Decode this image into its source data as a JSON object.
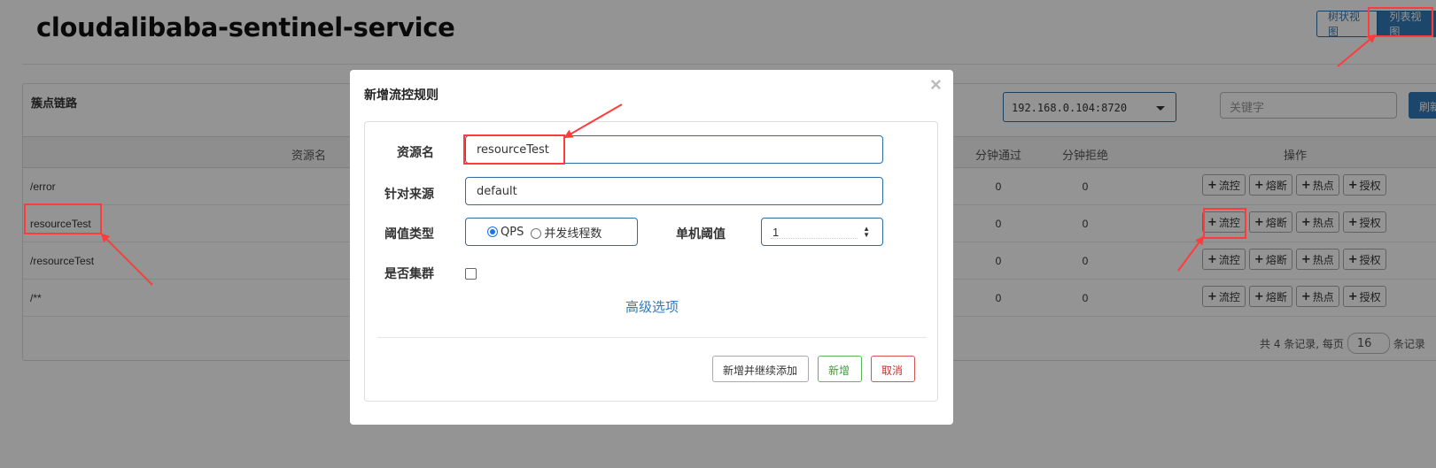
{
  "app": {
    "title": "cloudalibaba-sentinel-service"
  },
  "view_toggle": {
    "tree_label": "树状视图",
    "list_label": "列表视图"
  },
  "panel": {
    "title": "簇点链路",
    "machine_select_value": "192.168.0.104:8720",
    "keyword_placeholder": "关键字",
    "refresh_label": "刷新"
  },
  "table": {
    "headers": {
      "resource": "资源名",
      "pass_per_min": "分钟通过",
      "block_per_min": "分钟拒绝",
      "ops": "操作"
    },
    "op_labels": {
      "flow": "流控",
      "degrade": "熔断",
      "hotspot": "热点",
      "auth": "授权"
    },
    "rows": [
      {
        "name": "/error",
        "pass": "0",
        "block": "0"
      },
      {
        "name": "resourceTest",
        "pass": "0",
        "block": "0"
      },
      {
        "name": "/resourceTest",
        "pass": "0",
        "block": "0"
      },
      {
        "name": "/**",
        "pass": "0",
        "block": "0"
      }
    ]
  },
  "pager": {
    "prefix": "共 4 条记录, 每页",
    "page_size": "16",
    "suffix": "条记录"
  },
  "modal": {
    "title": "新增流控规则",
    "close": "×",
    "resource_label": "资源名",
    "resource_value": "resourceTest",
    "origin_label": "针对来源",
    "origin_value": "default",
    "threshold_type_label": "阈值类型",
    "threshold_options": [
      "QPS",
      "并发线程数"
    ],
    "threshold_selected": "QPS",
    "single_threshold_label": "单机阈值",
    "single_threshold_value": "1",
    "cluster_label": "是否集群",
    "cluster_checked": false,
    "advanced_label": "高级选项",
    "btn_add_continue": "新增并继续添加",
    "btn_add": "新增",
    "btn_cancel": "取消"
  },
  "colors": {
    "primary": "#337ab7",
    "highlight": "#ff3b3b",
    "success": "#5cb85c",
    "danger": "#d9534f"
  }
}
